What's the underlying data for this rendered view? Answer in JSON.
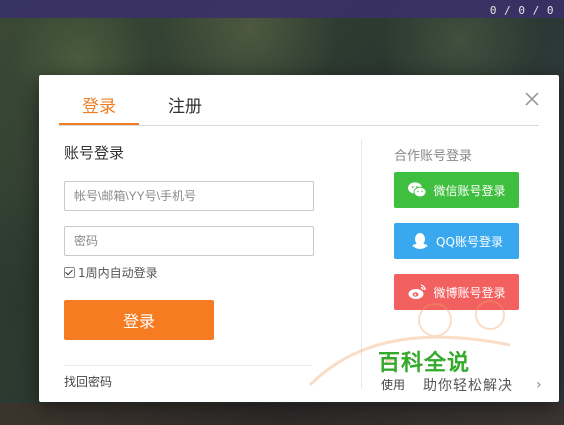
{
  "tabs": [
    {
      "label": "登录",
      "active": true
    },
    {
      "label": "注册",
      "active": false
    }
  ],
  "login": {
    "section_title": "账号登录",
    "account_placeholder": "帐号\\邮箱\\YY号\\手机号",
    "password_placeholder": "密码",
    "remember_label": "1周内自动登录",
    "remember_checked": true,
    "submit_label": "登录",
    "forgot_label": "找回密码"
  },
  "partner": {
    "title": "合作账号登录",
    "buttons": [
      {
        "label": "微信账号登录",
        "icon": "wechat-icon",
        "color": "#3fbf3f"
      },
      {
        "label": "QQ账号登录",
        "icon": "qq-icon",
        "color": "#3aa8ee"
      },
      {
        "label": "微博账号登录",
        "icon": "weibo-icon",
        "color": "#f26160"
      }
    ]
  },
  "footer": {
    "use_text": "使用",
    "watermark_title": "百科全说",
    "watermark_sub": "助你轻松解决"
  },
  "hud": {
    "score": "0 / 0 / 0"
  },
  "colors": {
    "accent": "#f07d22",
    "login_button": "#f77b20"
  }
}
